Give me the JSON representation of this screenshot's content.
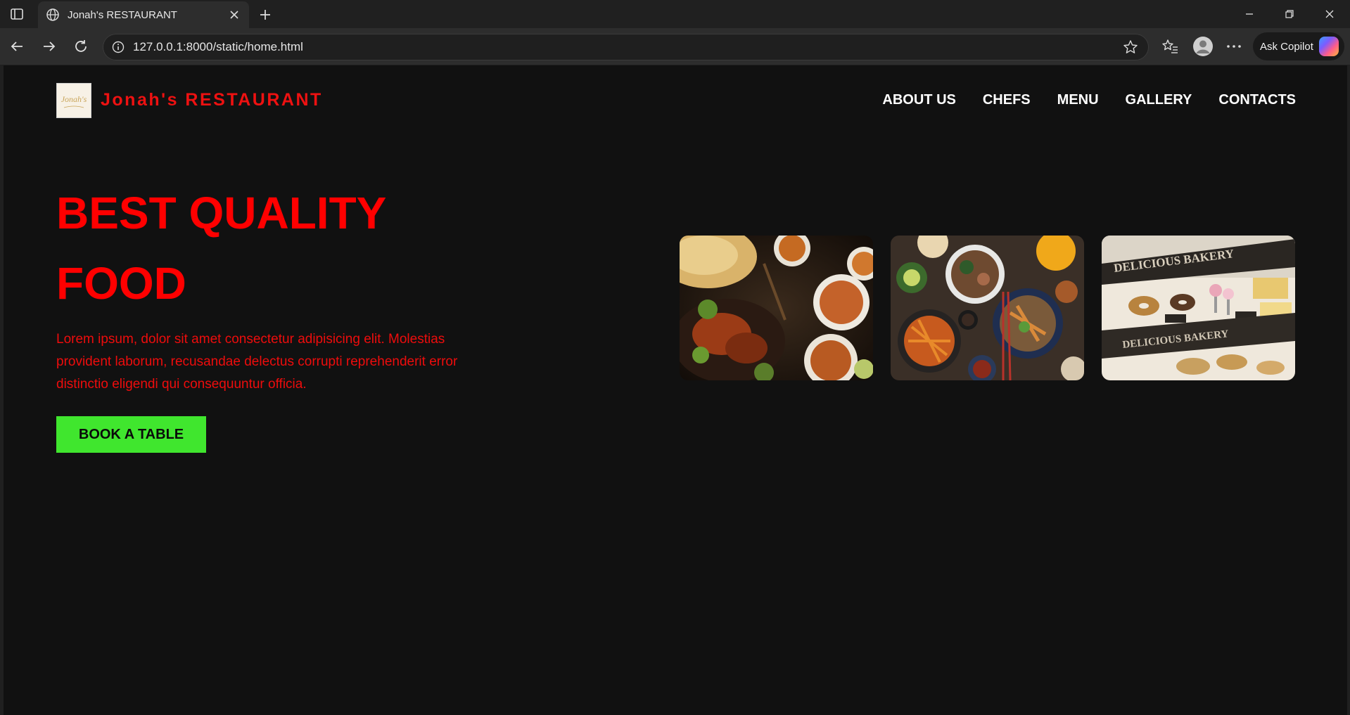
{
  "browser": {
    "tab_title": "Jonah's RESTAURANT",
    "url": "127.0.0.1:8000/static/home.html",
    "copilot_label": "Ask Copilot"
  },
  "site": {
    "brand": "Jonah's RESTAURANT",
    "logo_text": "Jonah's",
    "nav": [
      "ABOUT US",
      "CHEFS",
      "MENU",
      "GALLERY",
      "CONTACTS"
    ],
    "hero_title_line1": "BEST QUALITY",
    "hero_title_line2": "FOOD",
    "hero_text": "Lorem ipsum, dolor sit amet consectetur adipisicing elit. Molestias provident laborum, recusandae delectus corrupti reprehenderit error distinctio eligendi qui consequuntur officia.",
    "cta_label": "BOOK A TABLE",
    "bakery_sign": "DELICIOUS BAKERY"
  },
  "colors": {
    "brand_red": "#ff0000",
    "cta_green": "#40e62e",
    "page_bg": "#111111"
  }
}
